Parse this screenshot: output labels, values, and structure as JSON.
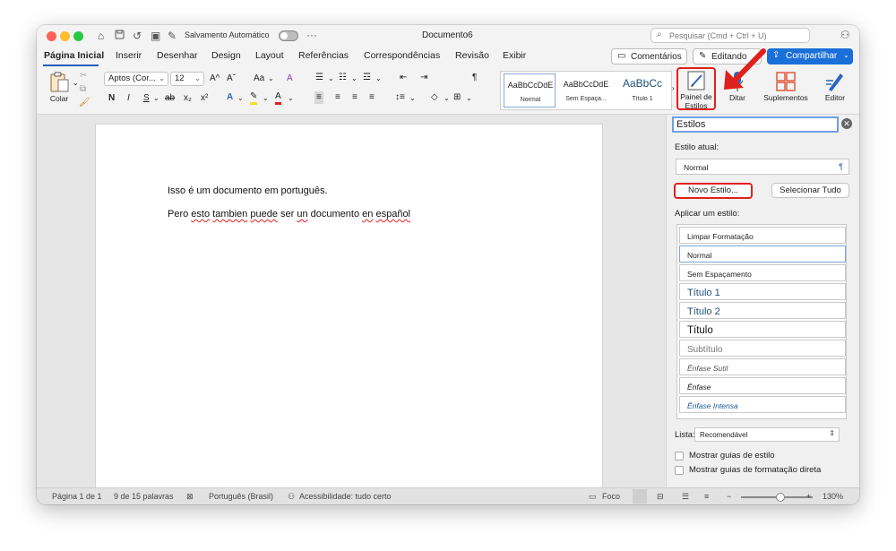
{
  "titlebar": {
    "autosave_label": "Salvamento Automático",
    "document_title": "Documento6",
    "search_placeholder": "Pesquisar (Cmd + Ctrl + U)",
    "more": "···"
  },
  "tabs": [
    {
      "label": "Página Inicial",
      "active": true
    },
    {
      "label": "Inserir"
    },
    {
      "label": "Desenhar"
    },
    {
      "label": "Design"
    },
    {
      "label": "Layout"
    },
    {
      "label": "Referências"
    },
    {
      "label": "Correspondências"
    },
    {
      "label": "Revisão"
    },
    {
      "label": "Exibir"
    }
  ],
  "header_buttons": {
    "comments": "Comentários",
    "editing": "Editando",
    "share": "Compartilhar"
  },
  "ribbon": {
    "paste_label": "Colar",
    "font_name": "Aptos (Cor...",
    "font_size": "12",
    "grow_font": "A^",
    "shrink_font": "Aˇ",
    "change_case": "Aa",
    "clear_format": "A",
    "bold": "N",
    "italic": "I",
    "underline": "S",
    "strike": "ab",
    "subscript": "x₂",
    "superscript": "x²",
    "pilcrow": "¶",
    "style_gallery": [
      {
        "preview": "AaBbCcDdE",
        "name": "Normal",
        "selected": true
      },
      {
        "preview": "AaBbCcDdE",
        "name": "Sem Espaça..."
      },
      {
        "preview": "AaBbCc",
        "name": "Título 1"
      }
    ],
    "styles_pane_label_1": "Painel de",
    "styles_pane_label_2": "Estilos",
    "dictate_label": "Ditar",
    "addins_label": "Suplementos",
    "editor_label": "Editor"
  },
  "document": {
    "line1": "Isso é um documento em português.",
    "line2_parts": [
      "Pero ",
      "esto",
      " ",
      "tambien",
      " ",
      "puede",
      " ser ",
      "un",
      " documento ",
      "en",
      " ",
      "español"
    ]
  },
  "styles_pane": {
    "title": "Estilos",
    "current_style_label": "Estilo atual:",
    "current_style": "Normal",
    "new_style_button": "Novo Estilo...",
    "select_all_button": "Selecionar Tudo",
    "apply_label": "Aplicar um estilo:",
    "styles": [
      {
        "name": "Limpar Formatação",
        "color": "#222222",
        "size": 8.5,
        "italic": false
      },
      {
        "name": "Normal",
        "color": "#222222",
        "size": 8.5,
        "italic": false,
        "selected": true
      },
      {
        "name": "Sem Espaçamento",
        "color": "#222222",
        "size": 8.5,
        "italic": false
      },
      {
        "name": "Título 1",
        "color": "#1f4e79",
        "size": 11,
        "italic": false
      },
      {
        "name": "Título 2",
        "color": "#1f4e79",
        "size": 11,
        "italic": false
      },
      {
        "name": "Título",
        "color": "#111111",
        "size": 11.5,
        "italic": false
      },
      {
        "name": "Subtítulo",
        "color": "#777777",
        "size": 10,
        "italic": false
      },
      {
        "name": "Ênfase Sutil",
        "color": "#555555",
        "size": 8.5,
        "italic": true
      },
      {
        "name": "Ênfase",
        "color": "#222222",
        "size": 8.5,
        "italic": true
      },
      {
        "name": "Ênfase Intensa",
        "color": "#1f5aa6",
        "size": 8.5,
        "italic": true
      }
    ],
    "list_label": "Lista:",
    "list_value": "Recomendável",
    "show_style_guides": "Mostrar guias de estilo",
    "show_direct_format_guides": "Mostrar guias de formatação direta"
  },
  "statusbar": {
    "page": "Página 1 de 1",
    "words": "9 de 15 palavras",
    "language": "Português (Brasil)",
    "accessibility": "Acessibilidade: tudo certo",
    "focus": "Foco",
    "zoom_minus": "−",
    "zoom_plus": "+",
    "zoom": "130%",
    "zoom_level": 0.55
  },
  "colors": {
    "accent": "#1a6fd8",
    "highlight_red": "#e0201c"
  }
}
